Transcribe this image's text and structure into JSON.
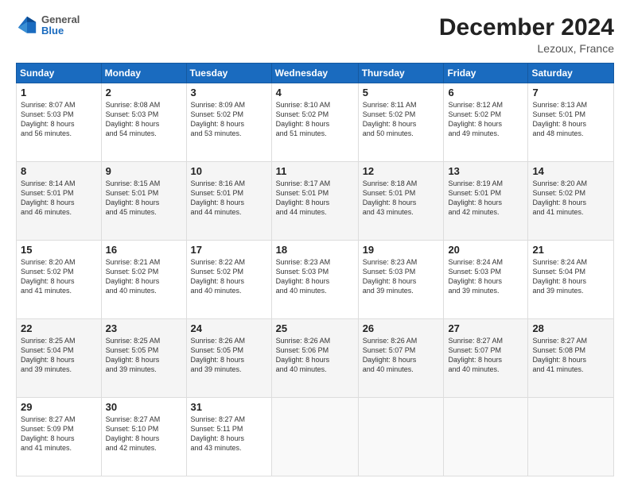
{
  "logo": {
    "general": "General",
    "blue": "Blue"
  },
  "header": {
    "month": "December 2024",
    "location": "Lezoux, France"
  },
  "weekdays": [
    "Sunday",
    "Monday",
    "Tuesday",
    "Wednesday",
    "Thursday",
    "Friday",
    "Saturday"
  ],
  "weeks": [
    [
      {
        "day": "1",
        "info": "Sunrise: 8:07 AM\nSunset: 5:03 PM\nDaylight: 8 hours\nand 56 minutes."
      },
      {
        "day": "2",
        "info": "Sunrise: 8:08 AM\nSunset: 5:03 PM\nDaylight: 8 hours\nand 54 minutes."
      },
      {
        "day": "3",
        "info": "Sunrise: 8:09 AM\nSunset: 5:02 PM\nDaylight: 8 hours\nand 53 minutes."
      },
      {
        "day": "4",
        "info": "Sunrise: 8:10 AM\nSunset: 5:02 PM\nDaylight: 8 hours\nand 51 minutes."
      },
      {
        "day": "5",
        "info": "Sunrise: 8:11 AM\nSunset: 5:02 PM\nDaylight: 8 hours\nand 50 minutes."
      },
      {
        "day": "6",
        "info": "Sunrise: 8:12 AM\nSunset: 5:02 PM\nDaylight: 8 hours\nand 49 minutes."
      },
      {
        "day": "7",
        "info": "Sunrise: 8:13 AM\nSunset: 5:01 PM\nDaylight: 8 hours\nand 48 minutes."
      }
    ],
    [
      {
        "day": "8",
        "info": "Sunrise: 8:14 AM\nSunset: 5:01 PM\nDaylight: 8 hours\nand 46 minutes."
      },
      {
        "day": "9",
        "info": "Sunrise: 8:15 AM\nSunset: 5:01 PM\nDaylight: 8 hours\nand 45 minutes."
      },
      {
        "day": "10",
        "info": "Sunrise: 8:16 AM\nSunset: 5:01 PM\nDaylight: 8 hours\nand 44 minutes."
      },
      {
        "day": "11",
        "info": "Sunrise: 8:17 AM\nSunset: 5:01 PM\nDaylight: 8 hours\nand 44 minutes."
      },
      {
        "day": "12",
        "info": "Sunrise: 8:18 AM\nSunset: 5:01 PM\nDaylight: 8 hours\nand 43 minutes."
      },
      {
        "day": "13",
        "info": "Sunrise: 8:19 AM\nSunset: 5:01 PM\nDaylight: 8 hours\nand 42 minutes."
      },
      {
        "day": "14",
        "info": "Sunrise: 8:20 AM\nSunset: 5:02 PM\nDaylight: 8 hours\nand 41 minutes."
      }
    ],
    [
      {
        "day": "15",
        "info": "Sunrise: 8:20 AM\nSunset: 5:02 PM\nDaylight: 8 hours\nand 41 minutes."
      },
      {
        "day": "16",
        "info": "Sunrise: 8:21 AM\nSunset: 5:02 PM\nDaylight: 8 hours\nand 40 minutes."
      },
      {
        "day": "17",
        "info": "Sunrise: 8:22 AM\nSunset: 5:02 PM\nDaylight: 8 hours\nand 40 minutes."
      },
      {
        "day": "18",
        "info": "Sunrise: 8:23 AM\nSunset: 5:03 PM\nDaylight: 8 hours\nand 40 minutes."
      },
      {
        "day": "19",
        "info": "Sunrise: 8:23 AM\nSunset: 5:03 PM\nDaylight: 8 hours\nand 39 minutes."
      },
      {
        "day": "20",
        "info": "Sunrise: 8:24 AM\nSunset: 5:03 PM\nDaylight: 8 hours\nand 39 minutes."
      },
      {
        "day": "21",
        "info": "Sunrise: 8:24 AM\nSunset: 5:04 PM\nDaylight: 8 hours\nand 39 minutes."
      }
    ],
    [
      {
        "day": "22",
        "info": "Sunrise: 8:25 AM\nSunset: 5:04 PM\nDaylight: 8 hours\nand 39 minutes."
      },
      {
        "day": "23",
        "info": "Sunrise: 8:25 AM\nSunset: 5:05 PM\nDaylight: 8 hours\nand 39 minutes."
      },
      {
        "day": "24",
        "info": "Sunrise: 8:26 AM\nSunset: 5:05 PM\nDaylight: 8 hours\nand 39 minutes."
      },
      {
        "day": "25",
        "info": "Sunrise: 8:26 AM\nSunset: 5:06 PM\nDaylight: 8 hours\nand 40 minutes."
      },
      {
        "day": "26",
        "info": "Sunrise: 8:26 AM\nSunset: 5:07 PM\nDaylight: 8 hours\nand 40 minutes."
      },
      {
        "day": "27",
        "info": "Sunrise: 8:27 AM\nSunset: 5:07 PM\nDaylight: 8 hours\nand 40 minutes."
      },
      {
        "day": "28",
        "info": "Sunrise: 8:27 AM\nSunset: 5:08 PM\nDaylight: 8 hours\nand 41 minutes."
      }
    ],
    [
      {
        "day": "29",
        "info": "Sunrise: 8:27 AM\nSunset: 5:09 PM\nDaylight: 8 hours\nand 41 minutes."
      },
      {
        "day": "30",
        "info": "Sunrise: 8:27 AM\nSunset: 5:10 PM\nDaylight: 8 hours\nand 42 minutes."
      },
      {
        "day": "31",
        "info": "Sunrise: 8:27 AM\nSunset: 5:11 PM\nDaylight: 8 hours\nand 43 minutes."
      },
      null,
      null,
      null,
      null
    ]
  ]
}
